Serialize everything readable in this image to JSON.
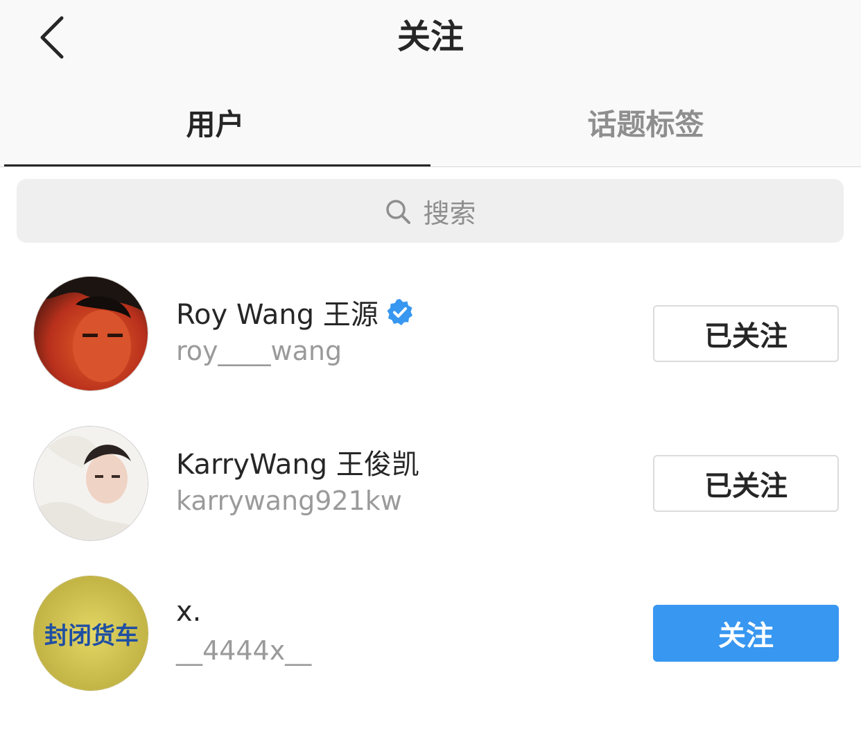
{
  "header": {
    "title": "关注",
    "back_icon": "chevron-left-icon"
  },
  "tabs": [
    {
      "label": "用户",
      "active": true
    },
    {
      "label": "话题标签",
      "active": false
    }
  ],
  "search": {
    "placeholder": "搜索",
    "icon": "search-icon"
  },
  "users": [
    {
      "name": "Roy Wang 王源",
      "handle": "roy____wang",
      "verified": true,
      "button": "已关注",
      "following": true
    },
    {
      "name": "KarryWang 王俊凯",
      "handle": "karrywang921kw",
      "verified": false,
      "button": "已关注",
      "following": true
    },
    {
      "name": "x.",
      "handle": "__4444x__",
      "verified": false,
      "button": "关注",
      "following": false,
      "avatar_text": "封闭货车"
    }
  ],
  "colors": {
    "accent": "#3897f0",
    "verified_badge": "#3897f0",
    "secondary_text": "#9a9a9a"
  }
}
